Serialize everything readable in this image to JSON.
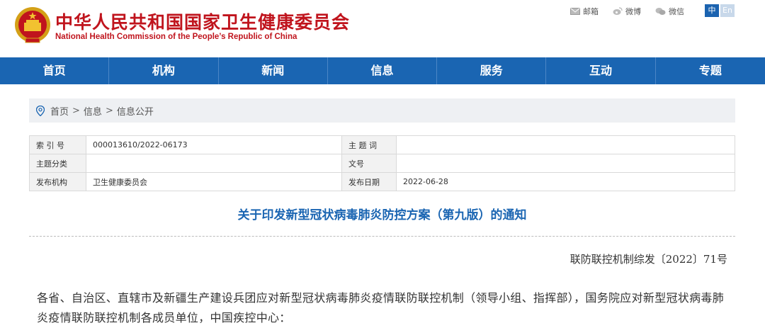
{
  "header": {
    "title_cn": "中华人民共和国国家卫生健康委员会",
    "title_en": "National Health Commission of the People’s Republic of China",
    "links": {
      "mail": "邮箱",
      "weibo": "微博",
      "wechat": "微信"
    },
    "lang": {
      "cn": "中",
      "en": "En"
    }
  },
  "colors": {
    "brand_red": "#c0141d",
    "nav_blue": "#1a65b2"
  },
  "nav": {
    "items": [
      "首页",
      "机构",
      "新闻",
      "信息",
      "服务",
      "互动",
      "专题"
    ]
  },
  "breadcrumb": {
    "icon": "location-pin-icon",
    "items": [
      "首页",
      "信息",
      "信息公开"
    ],
    "separator": ">"
  },
  "info_table": {
    "rows": [
      {
        "label1": "索 引 号",
        "value1": "000013610/2022-06173",
        "label2": "主 题 词",
        "value2": ""
      },
      {
        "label1": "主题分类",
        "value1": "",
        "label2": "文号",
        "value2": ""
      },
      {
        "label1": "发布机构",
        "value1": "卫生健康委员会",
        "label2": "发布日期",
        "value2": "2022-06-28"
      }
    ]
  },
  "article": {
    "title": "关于印发新型冠状病毒肺炎防控方案（第九版）的通知",
    "doc_number": "联防联控机制综发〔2022〕71号",
    "body": "各省、自治区、直辖市及新疆生产建设兵团应对新型冠状病毒肺炎疫情联防联控机制（领导小组、指挥部），国务院应对新型冠状病毒肺炎疫情联防联控机制各成员单位，中国疾控中心："
  }
}
